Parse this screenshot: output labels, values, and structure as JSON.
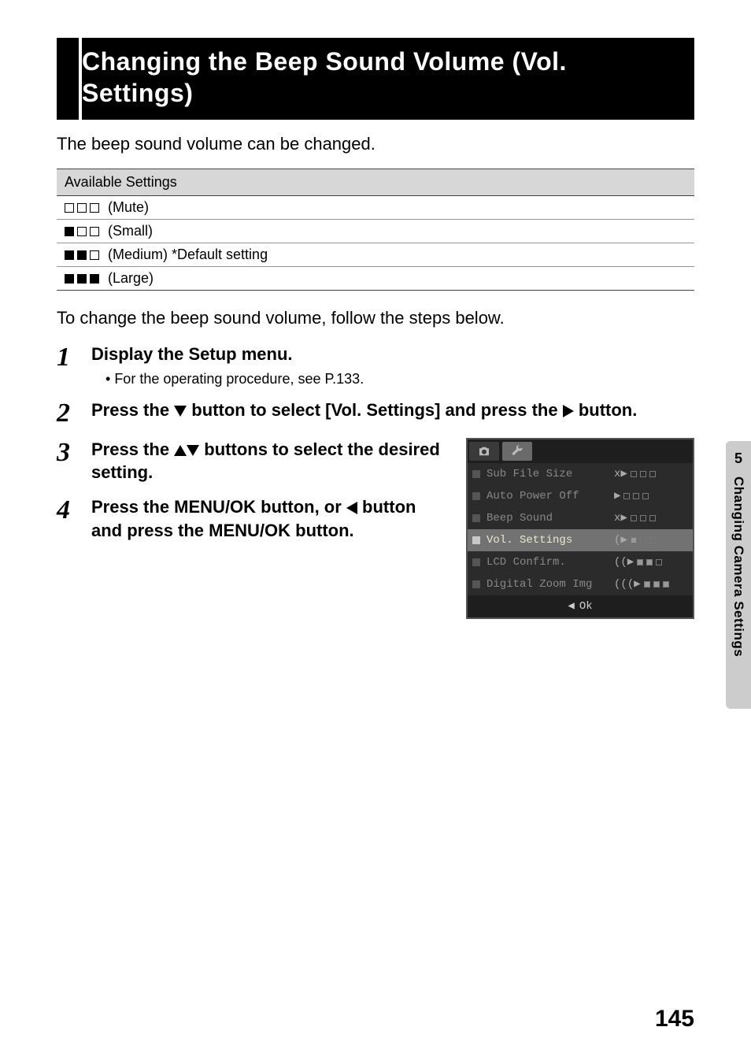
{
  "title": "Changing the Beep Sound Volume (Vol. Settings)",
  "intro": "The beep sound volume can be changed.",
  "settings_header": "Available Settings",
  "settings": [
    {
      "filled": 0,
      "label": "(Mute)"
    },
    {
      "filled": 1,
      "label": "(Small)"
    },
    {
      "filled": 2,
      "label": "(Medium) *Default setting"
    },
    {
      "filled": 3,
      "label": "(Large)"
    }
  ],
  "subintro": "To change the beep sound volume, follow the steps below.",
  "steps": {
    "s1": {
      "num": "1",
      "title": "Display the Setup menu.",
      "sub": "For the operating procedure, see P.133."
    },
    "s2": {
      "num": "2",
      "title_pre": "Press the ",
      "title_mid": " button to select [Vol. Settings] and press the ",
      "title_post": " button."
    },
    "s3": {
      "num": "3",
      "title_pre": "Press the ",
      "title_post": " buttons to select the desired setting."
    },
    "s4": {
      "num": "4",
      "title_pre": "Press the MENU/OK button, or ",
      "title_post": " button and press the MENU/OK button."
    }
  },
  "menu": {
    "items": [
      {
        "label": "Sub File Size",
        "speaker": "x",
        "filled": 0
      },
      {
        "label": "Auto Power Off",
        "speaker": "",
        "filled": 0
      },
      {
        "label": "Beep Sound",
        "speaker": "x",
        "filled": 0
      },
      {
        "label": "Vol. Settings",
        "speaker": ")",
        "filled": 1
      },
      {
        "label": "LCD Confirm.",
        "speaker": "))",
        "filled": 2
      },
      {
        "label": "Digital Zoom Img",
        "speaker": ")))",
        "filled": 3
      }
    ],
    "selected_index": 3,
    "ok_label": "Ok"
  },
  "side": {
    "chapter_num": "5",
    "chapter_title": "Changing Camera Settings"
  },
  "page_number": "145"
}
